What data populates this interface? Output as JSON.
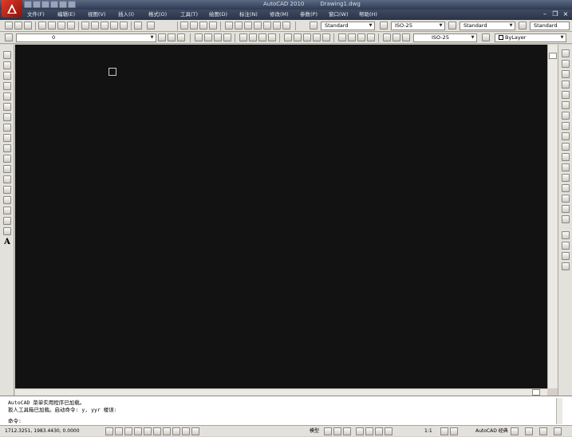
{
  "titlebar": {
    "app": "AutoCAD 2010",
    "document": "Drawing1.dwg"
  },
  "menu": {
    "items": [
      "文件(F)",
      "编辑(E)",
      "视图(V)",
      "插入(I)",
      "格式(O)",
      "工具(T)",
      "绘图(D)",
      "标注(N)",
      "修改(M)",
      "参数(P)",
      "窗口(W)",
      "帮助(H)"
    ]
  },
  "toolbar1": {
    "text_style": "Standard",
    "dim_style": "ISO-25",
    "table_style": "Standard",
    "multileader_style": "Standard"
  },
  "toolbar2": {
    "layer": "0",
    "dim_style": "ISO-25",
    "color": "ByLayer"
  },
  "left_toolbar": {
    "text_tool": "A"
  },
  "command": {
    "lines": [
      "AutoCAD 菜单实用程序已加载。",
      "扳人工具箱已加载。启动命令: y, yyr 楼误:"
    ],
    "prompt": "命令:"
  },
  "status": {
    "coordinates": "1712.3251, 1983.4430, 0.0000",
    "model": "模型",
    "scale": "1:1",
    "workspace": "AutoCAD 经典"
  },
  "colors": {
    "canvas_bg": "#121212",
    "title_bar": "#2e3a52",
    "logo_red": "#e23a2a"
  }
}
